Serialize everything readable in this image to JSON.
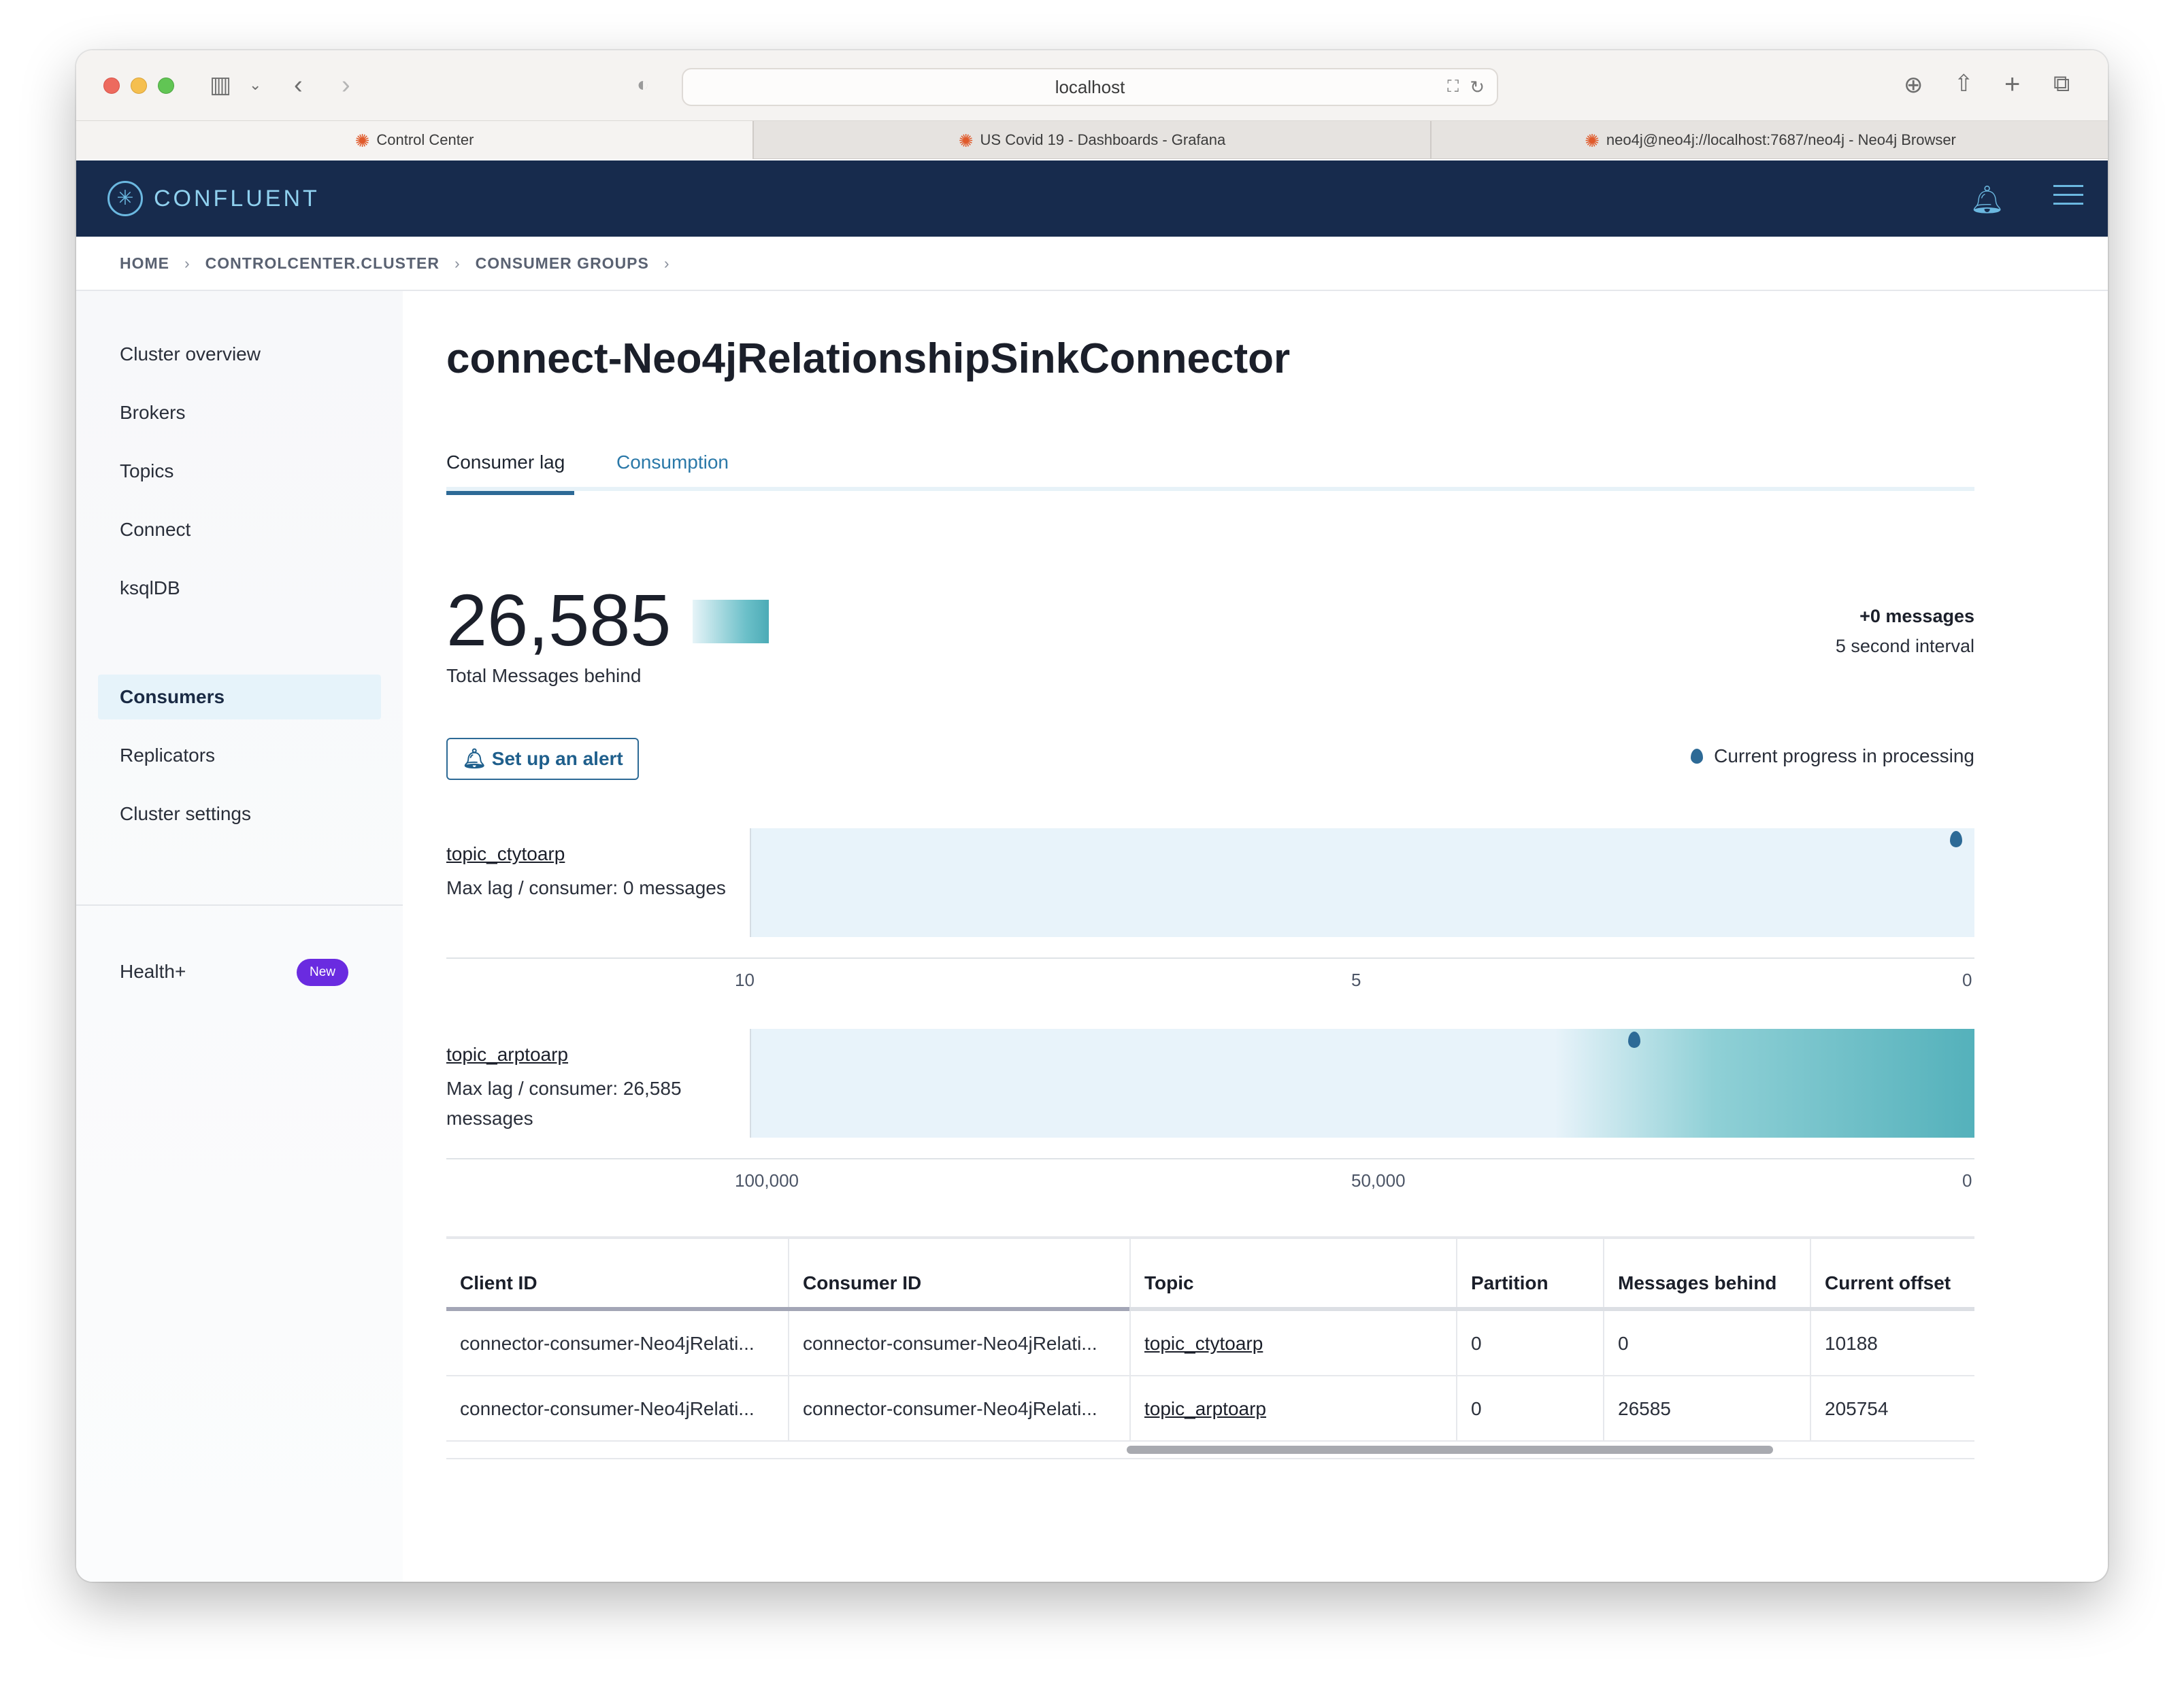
{
  "browser": {
    "url": "localhost",
    "tabs": [
      {
        "label": "Control Center",
        "active": true,
        "icon": "grafana-icon"
      },
      {
        "label": "US Covid 19 - Dashboards - Grafana",
        "active": false,
        "icon": "grafana-icon"
      },
      {
        "label": "neo4j@neo4j://localhost:7687/neo4j - Neo4j Browser",
        "active": false,
        "icon": "grafana-icon"
      }
    ]
  },
  "header": {
    "brand": "CONFLUENT",
    "accent_color": "#172b4d"
  },
  "breadcrumb": [
    "HOME",
    "CONTROLCENTER.CLUSTER",
    "CONSUMER GROUPS"
  ],
  "sidebar": {
    "items": [
      {
        "label": "Cluster overview",
        "active": false
      },
      {
        "label": "Brokers",
        "active": false
      },
      {
        "label": "Topics",
        "active": false
      },
      {
        "label": "Connect",
        "active": false
      },
      {
        "label": "ksqlDB",
        "active": false
      },
      {
        "label": "Consumers",
        "active": true
      },
      {
        "label": "Replicators",
        "active": false
      },
      {
        "label": "Cluster settings",
        "active": false
      }
    ],
    "health": {
      "label": "Health+",
      "badge": "New"
    }
  },
  "main": {
    "title": "connect-Neo4jRelationshipSinkConnector",
    "tabs": [
      {
        "label": "Consumer lag",
        "active": true
      },
      {
        "label": "Consumption",
        "active": false
      }
    ],
    "total": {
      "value": "26,585",
      "label": "Total Messages behind"
    },
    "delta": {
      "value": "+0 messages",
      "interval": "5 second interval"
    },
    "alert_button": "Set up an alert",
    "legend": "Current progress in processing",
    "topics": [
      {
        "name": "topic_ctytoarp",
        "sub": "Max lag / consumer: 0 messages",
        "ticks": [
          "10",
          "5",
          "0"
        ],
        "axis_max": 10,
        "lag": 0,
        "marker_value": 0.15
      },
      {
        "name": "topic_arptoarp",
        "sub": "Max lag / consumer: 26,585 messages",
        "ticks": [
          "100,000",
          "50,000",
          "0"
        ],
        "axis_max": 100000,
        "lag": 26585,
        "marker_value": 27800
      }
    ]
  },
  "table": {
    "columns": [
      "Client ID",
      "Consumer ID",
      "Topic",
      "Partition",
      "Messages behind",
      "Current offset"
    ],
    "rows": [
      [
        "connector-consumer-Neo4jRelati...",
        "connector-consumer-Neo4jRelati...",
        "topic_ctytoarp",
        "0",
        "0",
        "10188"
      ],
      [
        "connector-consumer-Neo4jRelati...",
        "connector-consumer-Neo4jRelati...",
        "topic_arptoarp",
        "0",
        "26585",
        "205754"
      ]
    ]
  }
}
